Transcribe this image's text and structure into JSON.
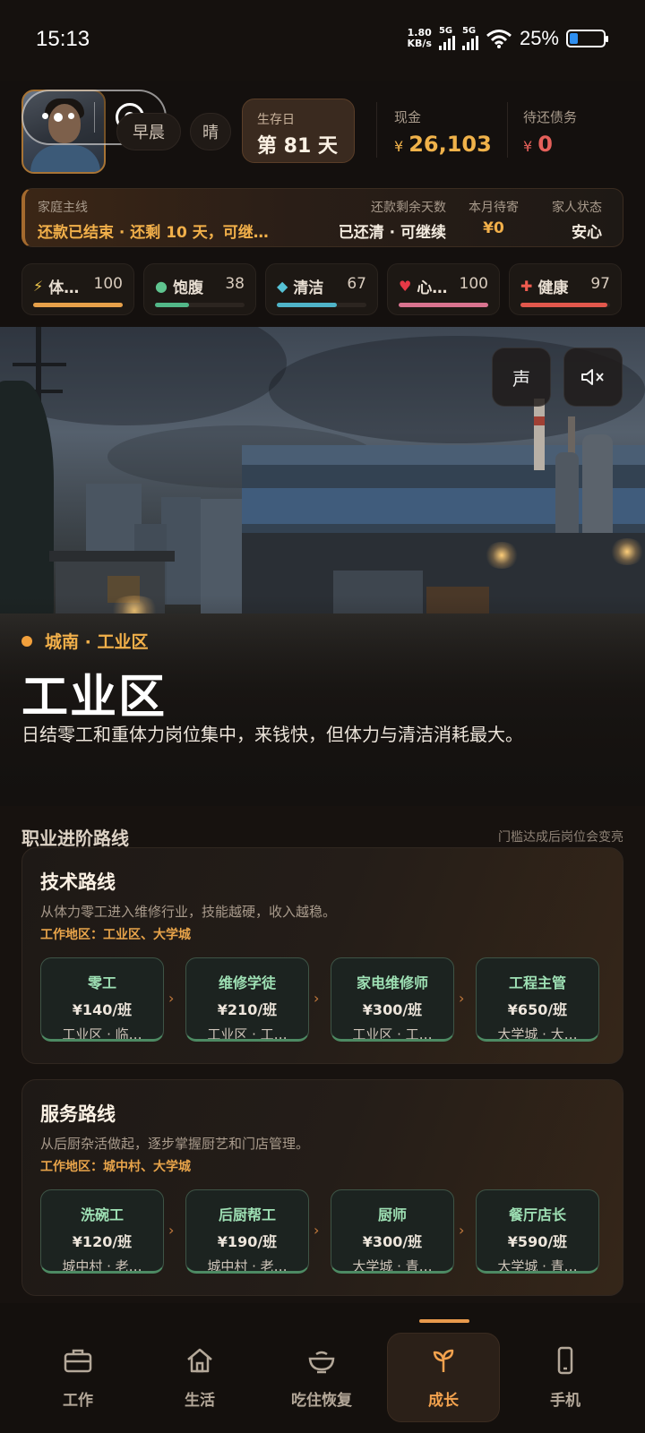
{
  "status_bar": {
    "time": "15:13",
    "net_speed_value": "1.80",
    "net_speed_unit": "KB/s",
    "sim1": "5G",
    "sim2": "5G",
    "battery": "25%",
    "battery_level": 0.25
  },
  "header": {
    "time_of_day": "早晨",
    "weather": "晴",
    "survival_day_label": "生存日",
    "survival_day_value": "第 81 天",
    "cash_label": "现金",
    "cash_currency": "¥",
    "cash_value": "26,103",
    "debt_label": "待还债务",
    "debt_currency": "¥",
    "debt_value": "0"
  },
  "quest": {
    "main_label": "家庭主线",
    "main_value": "还款已结束 · 还剩 10 天，可继…",
    "repay_label": "还款剩余天数",
    "repay_value": "已还清 · 可继续",
    "remit_label": "本月待寄",
    "remit_value": "¥0",
    "family_label": "家人状态",
    "family_value": "安心"
  },
  "stats": [
    {
      "icon": "lightning-icon",
      "glyph": "⚡",
      "name": "体…",
      "value": "100",
      "level": 1.0,
      "color": "#e6a04a",
      "icon_color": "#f2c94c"
    },
    {
      "icon": "dot-icon",
      "glyph": "●",
      "name": "饱腹",
      "value": "38",
      "level": 0.38,
      "color": "#52b788",
      "icon_color": "#5fc48f"
    },
    {
      "icon": "diamond-icon",
      "glyph": "◆",
      "name": "清洁",
      "value": "67",
      "level": 0.67,
      "color": "#4fb4c8",
      "icon_color": "#56c2d6"
    },
    {
      "icon": "heart-icon",
      "glyph": "♥",
      "name": "心…",
      "value": "100",
      "level": 1.0,
      "color": "#d9738f",
      "icon_color": "#e63946"
    },
    {
      "icon": "plus-icon",
      "glyph": "✚",
      "name": "健康",
      "value": "97",
      "level": 0.97,
      "color": "#e2574c",
      "icon_color": "#ef5b4f"
    }
  ],
  "hero": {
    "sound_label": "声",
    "location": "城南 · 工业区",
    "title": "工业区",
    "description": "日结零工和重体力岗位集中，来钱快，但体力与清洁消耗最大。"
  },
  "career": {
    "section_title": "职业进阶路线",
    "section_hint": "门槛达成后岗位会变亮",
    "routes": [
      {
        "title": "技术路线",
        "description": "从体力零工进入维修行业，技能越硬，收入越稳。",
        "area": "工作地区：工业区、大学城",
        "steps": [
          {
            "name": "零工",
            "pay": "¥140/班",
            "place": "工业区 · 临…"
          },
          {
            "name": "维修学徒",
            "pay": "¥210/班",
            "place": "工业区 · 工…"
          },
          {
            "name": "家电维修师",
            "pay": "¥300/班",
            "place": "工业区 · 工…"
          },
          {
            "name": "工程主管",
            "pay": "¥650/班",
            "place": "大学城 · 大…"
          }
        ]
      },
      {
        "title": "服务路线",
        "description": "从后厨杂活做起，逐步掌握厨艺和门店管理。",
        "area": "工作地区：城中村、大学城",
        "steps": [
          {
            "name": "洗碗工",
            "pay": "¥120/班",
            "place": "城中村 · 老…"
          },
          {
            "name": "后厨帮工",
            "pay": "¥190/班",
            "place": "城中村 · 老…"
          },
          {
            "name": "厨师",
            "pay": "¥300/班",
            "place": "大学城 · 青…"
          },
          {
            "name": "餐厅店长",
            "pay": "¥590/班",
            "place": "大学城 · 青…"
          }
        ]
      }
    ]
  },
  "nav": [
    {
      "label": "工作",
      "icon": "briefcase-icon"
    },
    {
      "label": "生活",
      "icon": "home-icon"
    },
    {
      "label": "吃住恢复",
      "icon": "bowl-icon"
    },
    {
      "label": "成长",
      "icon": "sprout-icon",
      "active": true
    },
    {
      "label": "手机",
      "icon": "phone-icon"
    }
  ],
  "colors": {
    "accent": "#f3a24e",
    "gold": "#f0b24a",
    "danger": "#e5605a",
    "step_green": "#9ee0b4"
  }
}
